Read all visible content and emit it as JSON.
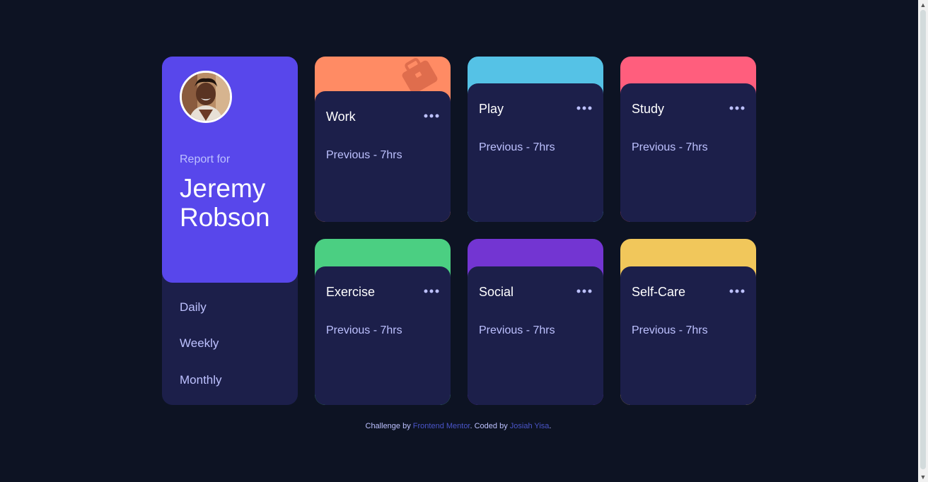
{
  "profile": {
    "report_for": "Report for",
    "name_line1": "Jeremy",
    "name_line2": "Robson",
    "periods": [
      "Daily",
      "Weekly",
      "Monthly"
    ]
  },
  "cards": [
    {
      "title": "Work",
      "previous": "Previous - 7hrs",
      "color": "#ff8b64",
      "icon": "work-icon"
    },
    {
      "title": "Play",
      "previous": "Previous - 7hrs",
      "color": "#55c2e6",
      "icon": "play-icon"
    },
    {
      "title": "Study",
      "previous": "Previous - 7hrs",
      "color": "#ff5e7d",
      "icon": "study-icon"
    },
    {
      "title": "Exercise",
      "previous": "Previous - 7hrs",
      "color": "#4bcf82",
      "icon": "exercise-icon"
    },
    {
      "title": "Social",
      "previous": "Previous - 7hrs",
      "color": "#7335d2",
      "icon": "social-icon"
    },
    {
      "title": "Self-Care",
      "previous": "Previous - 7hrs",
      "color": "#f1c75b",
      "icon": "self-care-icon"
    }
  ],
  "footer": {
    "challenge_by": "Challenge by ",
    "frontend_mentor": "Frontend Mentor",
    "coded_by": ". Coded by ",
    "author": "Josiah Yisa",
    "end": "."
  },
  "colors": {
    "background": "#0d1323",
    "card_body": "#1c1f4a",
    "profile_accent": "#5847eb",
    "muted_text": "#bdc1ff",
    "link": "#4a55c9"
  }
}
